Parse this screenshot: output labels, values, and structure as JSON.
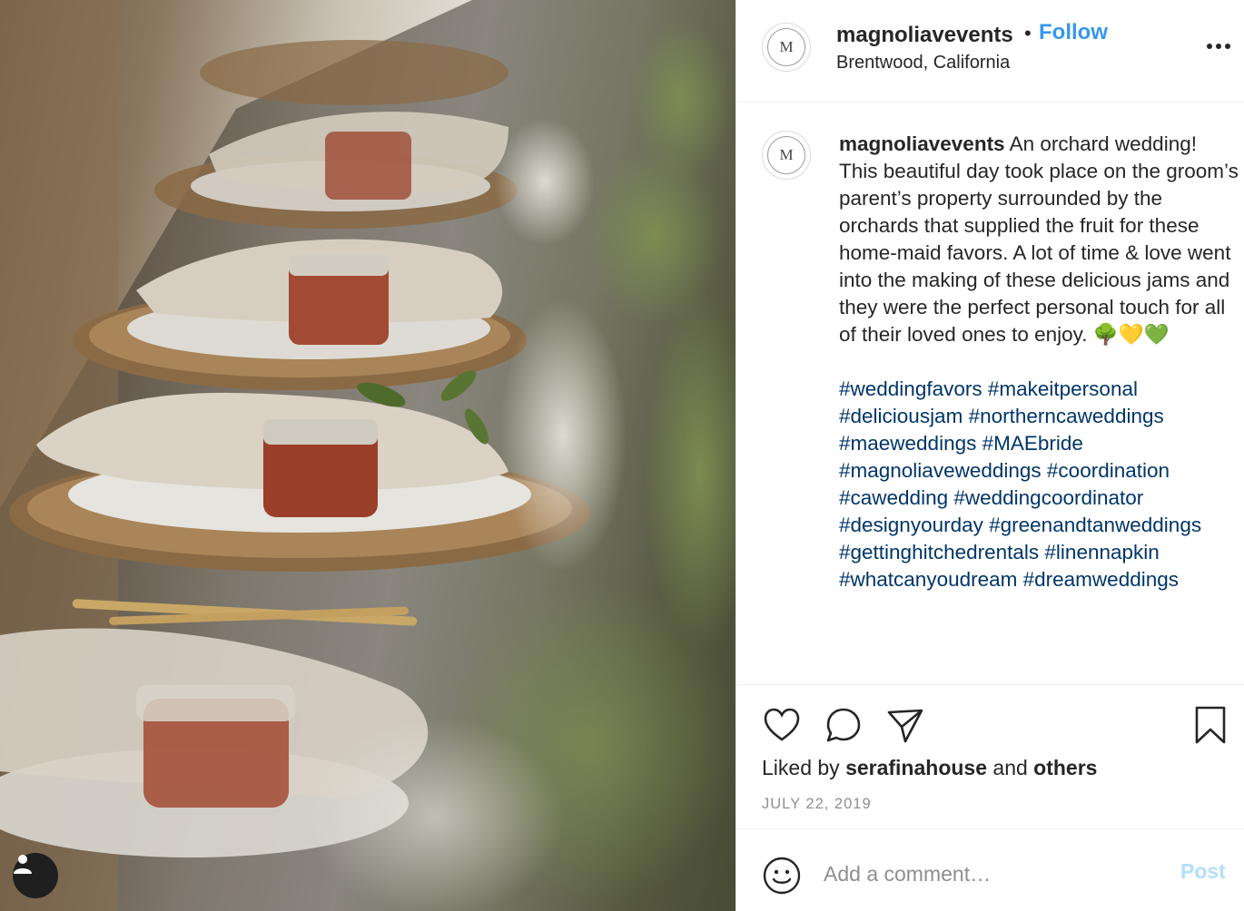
{
  "header": {
    "username": "magnoliavevents",
    "separator": "•",
    "follow_label": "Follow",
    "location": "Brentwood, California",
    "avatar_letter": "M"
  },
  "caption": {
    "username": "magnoliavevents",
    "text": "An orchard wedding! This beautiful day took place on the groom’s parent’s property surrounded by the orchards that supplied the fruit for these home-maid favors. A lot of time & love went into the making of these delicious jams and they were the perfect personal touch for all of their loved ones to enjoy. 🌳💛💚",
    "hashtags": [
      "#weddingfavors",
      "#makeitpersonal",
      "#deliciousjam",
      "#northerncaweddings",
      "#maeweddings",
      "#MAEbride",
      "#magnoliaveweddings",
      "#coordination",
      "#cawedding",
      "#weddingcoordinator",
      "#designyourday",
      "#greenandtanweddings",
      "#gettinghitchedrentals",
      "#linennapkin",
      "#whatcanyoudream",
      "#dreamweddings"
    ]
  },
  "likes": {
    "prefix": "Liked by",
    "user": "serafinahouse",
    "joiner": "and",
    "others": "others"
  },
  "date": "JULY 22, 2019",
  "comment": {
    "placeholder": "Add a comment…",
    "post_label": "Post"
  },
  "colors": {
    "follow": "#3897f0",
    "hashtag": "#003569",
    "post_disabled": "#b2dffc",
    "muted": "#8e8e8e"
  },
  "icons": [
    "user-tag-icon",
    "more-options-icon",
    "heart-icon",
    "comment-icon",
    "share-icon",
    "bookmark-icon",
    "emoji-icon"
  ]
}
